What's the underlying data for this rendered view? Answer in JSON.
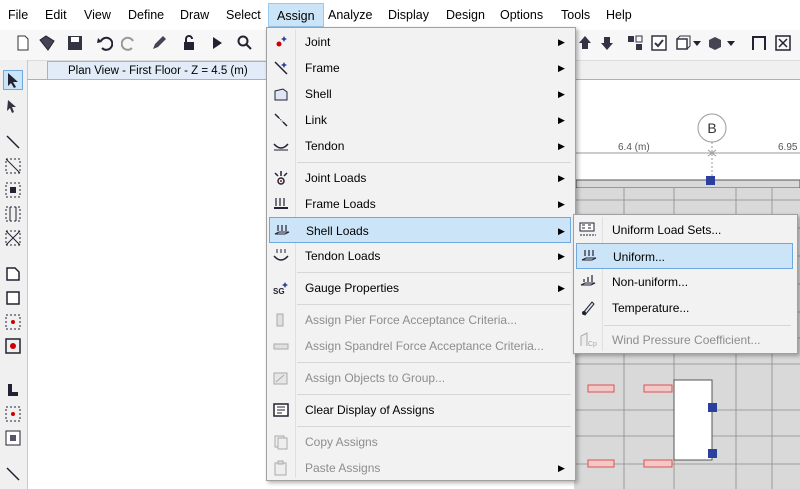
{
  "menubar": {
    "items": [
      "File",
      "Edit",
      "View",
      "Define",
      "Draw",
      "Select",
      "Assign",
      "Analyze",
      "Display",
      "Design",
      "Options",
      "Tools",
      "Help"
    ],
    "active": "Assign"
  },
  "tab": {
    "title": "Plan View - First Floor - Z = 4.5 (m)"
  },
  "canvas": {
    "gridline_bubble": "B",
    "dim_label_1": "6.4 (m)",
    "dim_label_2": "6.95"
  },
  "assign_menu": {
    "items": [
      {
        "label": "Joint",
        "icon": "joint-icon",
        "submenu": true,
        "enabled": true
      },
      {
        "label": "Frame",
        "icon": "frame-icon",
        "submenu": true,
        "enabled": true
      },
      {
        "label": "Shell",
        "icon": "shell-icon",
        "submenu": true,
        "enabled": true
      },
      {
        "label": "Link",
        "icon": "link-icon",
        "submenu": true,
        "enabled": true
      },
      {
        "label": "Tendon",
        "icon": "tendon-icon",
        "submenu": true,
        "enabled": true
      },
      {
        "label": "Joint Loads",
        "icon": "joint-loads-icon",
        "submenu": true,
        "enabled": true
      },
      {
        "label": "Frame Loads",
        "icon": "frame-loads-icon",
        "submenu": true,
        "enabled": true
      },
      {
        "label": "Shell Loads",
        "icon": "shell-loads-icon",
        "submenu": true,
        "enabled": true,
        "highlighted": true
      },
      {
        "label": "Tendon Loads",
        "icon": "tendon-loads-icon",
        "submenu": true,
        "enabled": true
      },
      {
        "label": "Gauge Properties",
        "icon": "gauge-icon",
        "submenu": true,
        "enabled": true
      },
      {
        "label": "Assign Pier Force Acceptance Criteria...",
        "icon": "pier-icon",
        "submenu": false,
        "enabled": false
      },
      {
        "label": "Assign Spandrel Force Acceptance Criteria...",
        "icon": "spandrel-icon",
        "submenu": false,
        "enabled": false
      },
      {
        "label": "Assign Objects to Group...",
        "icon": "group-icon",
        "submenu": false,
        "enabled": false
      },
      {
        "label": "Clear Display of Assigns",
        "icon": "clear-display-icon",
        "submenu": false,
        "enabled": true
      },
      {
        "label": "Copy Assigns",
        "icon": "copy-icon",
        "submenu": false,
        "enabled": false
      },
      {
        "label": "Paste Assigns",
        "icon": "paste-icon",
        "submenu": true,
        "enabled": false
      }
    ]
  },
  "shell_loads_submenu": {
    "items": [
      {
        "label": "Uniform Load Sets...",
        "icon": "uniform-load-sets-icon",
        "enabled": true
      },
      {
        "label": "Uniform...",
        "icon": "uniform-icon",
        "enabled": true,
        "highlighted": true
      },
      {
        "label": "Non-uniform...",
        "icon": "non-uniform-icon",
        "enabled": true
      },
      {
        "label": "Temperature...",
        "icon": "temperature-icon",
        "enabled": true
      },
      {
        "label": "Wind Pressure Coefficient...",
        "icon": "wind-pressure-icon",
        "enabled": false
      }
    ]
  },
  "colors": {
    "highlight": "#cce4f7",
    "highlight_border": "#6fa8dc",
    "beam_red": "#d9534f",
    "joint_blue": "#2a3f9e",
    "slab_gray": "#d9d9d9"
  }
}
